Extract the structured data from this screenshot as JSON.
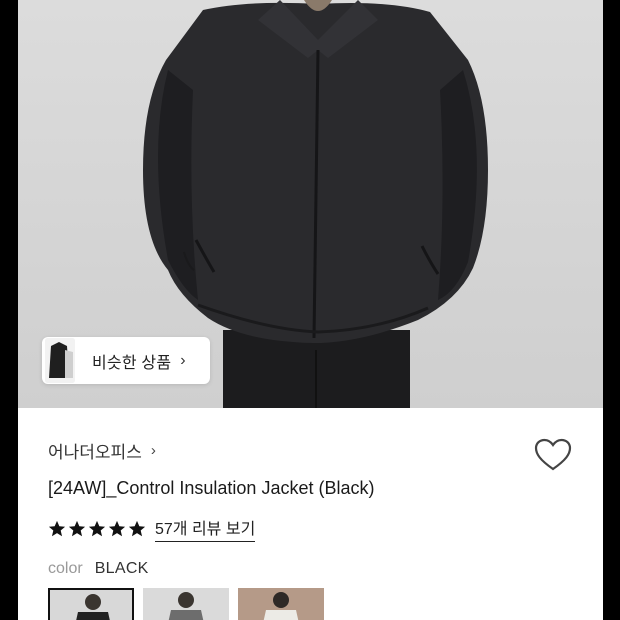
{
  "product": {
    "similar_button_label": "비슷한 상품",
    "brand": "어나더오피스",
    "title": "[24AW]_Control Insulation Jacket (Black)",
    "rating_stars": 5,
    "review_link": "57개 리뷰 보기",
    "color_key": "color",
    "color_value": "BLACK",
    "wishlist_icon": "heart-outline-icon",
    "swatches": [
      {
        "name": "black",
        "selected": true
      },
      {
        "name": "charcoal",
        "selected": false
      },
      {
        "name": "ivory",
        "selected": false
      }
    ]
  },
  "colors": {
    "star": "#111111",
    "link": "#222222",
    "muted": "#999999"
  }
}
